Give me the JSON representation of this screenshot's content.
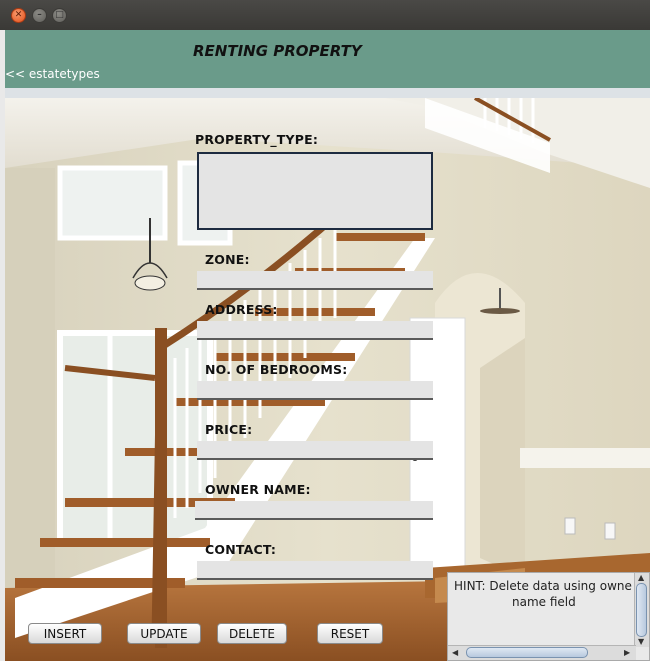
{
  "header": {
    "title": "RENTING PROPERTY",
    "back_link": "<< estatetypes"
  },
  "form": {
    "property_type_label": "PROPERTY_TYPE:",
    "property_type_value": "",
    "zone_label": "ZONE:",
    "zone_value": "",
    "address_label": "ADDRESS:",
    "address_value": "",
    "bedrooms_label": "NO. OF BEDROOMS:",
    "bedrooms_value": "",
    "price_label": "PRICE:",
    "price_value": "",
    "owner_label": "OWNER NAME:",
    "owner_value": "",
    "contact_label": "CONTACT:",
    "contact_value": ""
  },
  "buttons": {
    "insert": "INSERT",
    "update": "UPDATE",
    "delete": "DELETE",
    "reset": "RESET"
  },
  "hint": {
    "line1": "HINT: Delete data using owne",
    "line2": "name field"
  },
  "colors": {
    "header_bg": "#6a9b8a",
    "titlebar_bg": "#3a3936"
  }
}
